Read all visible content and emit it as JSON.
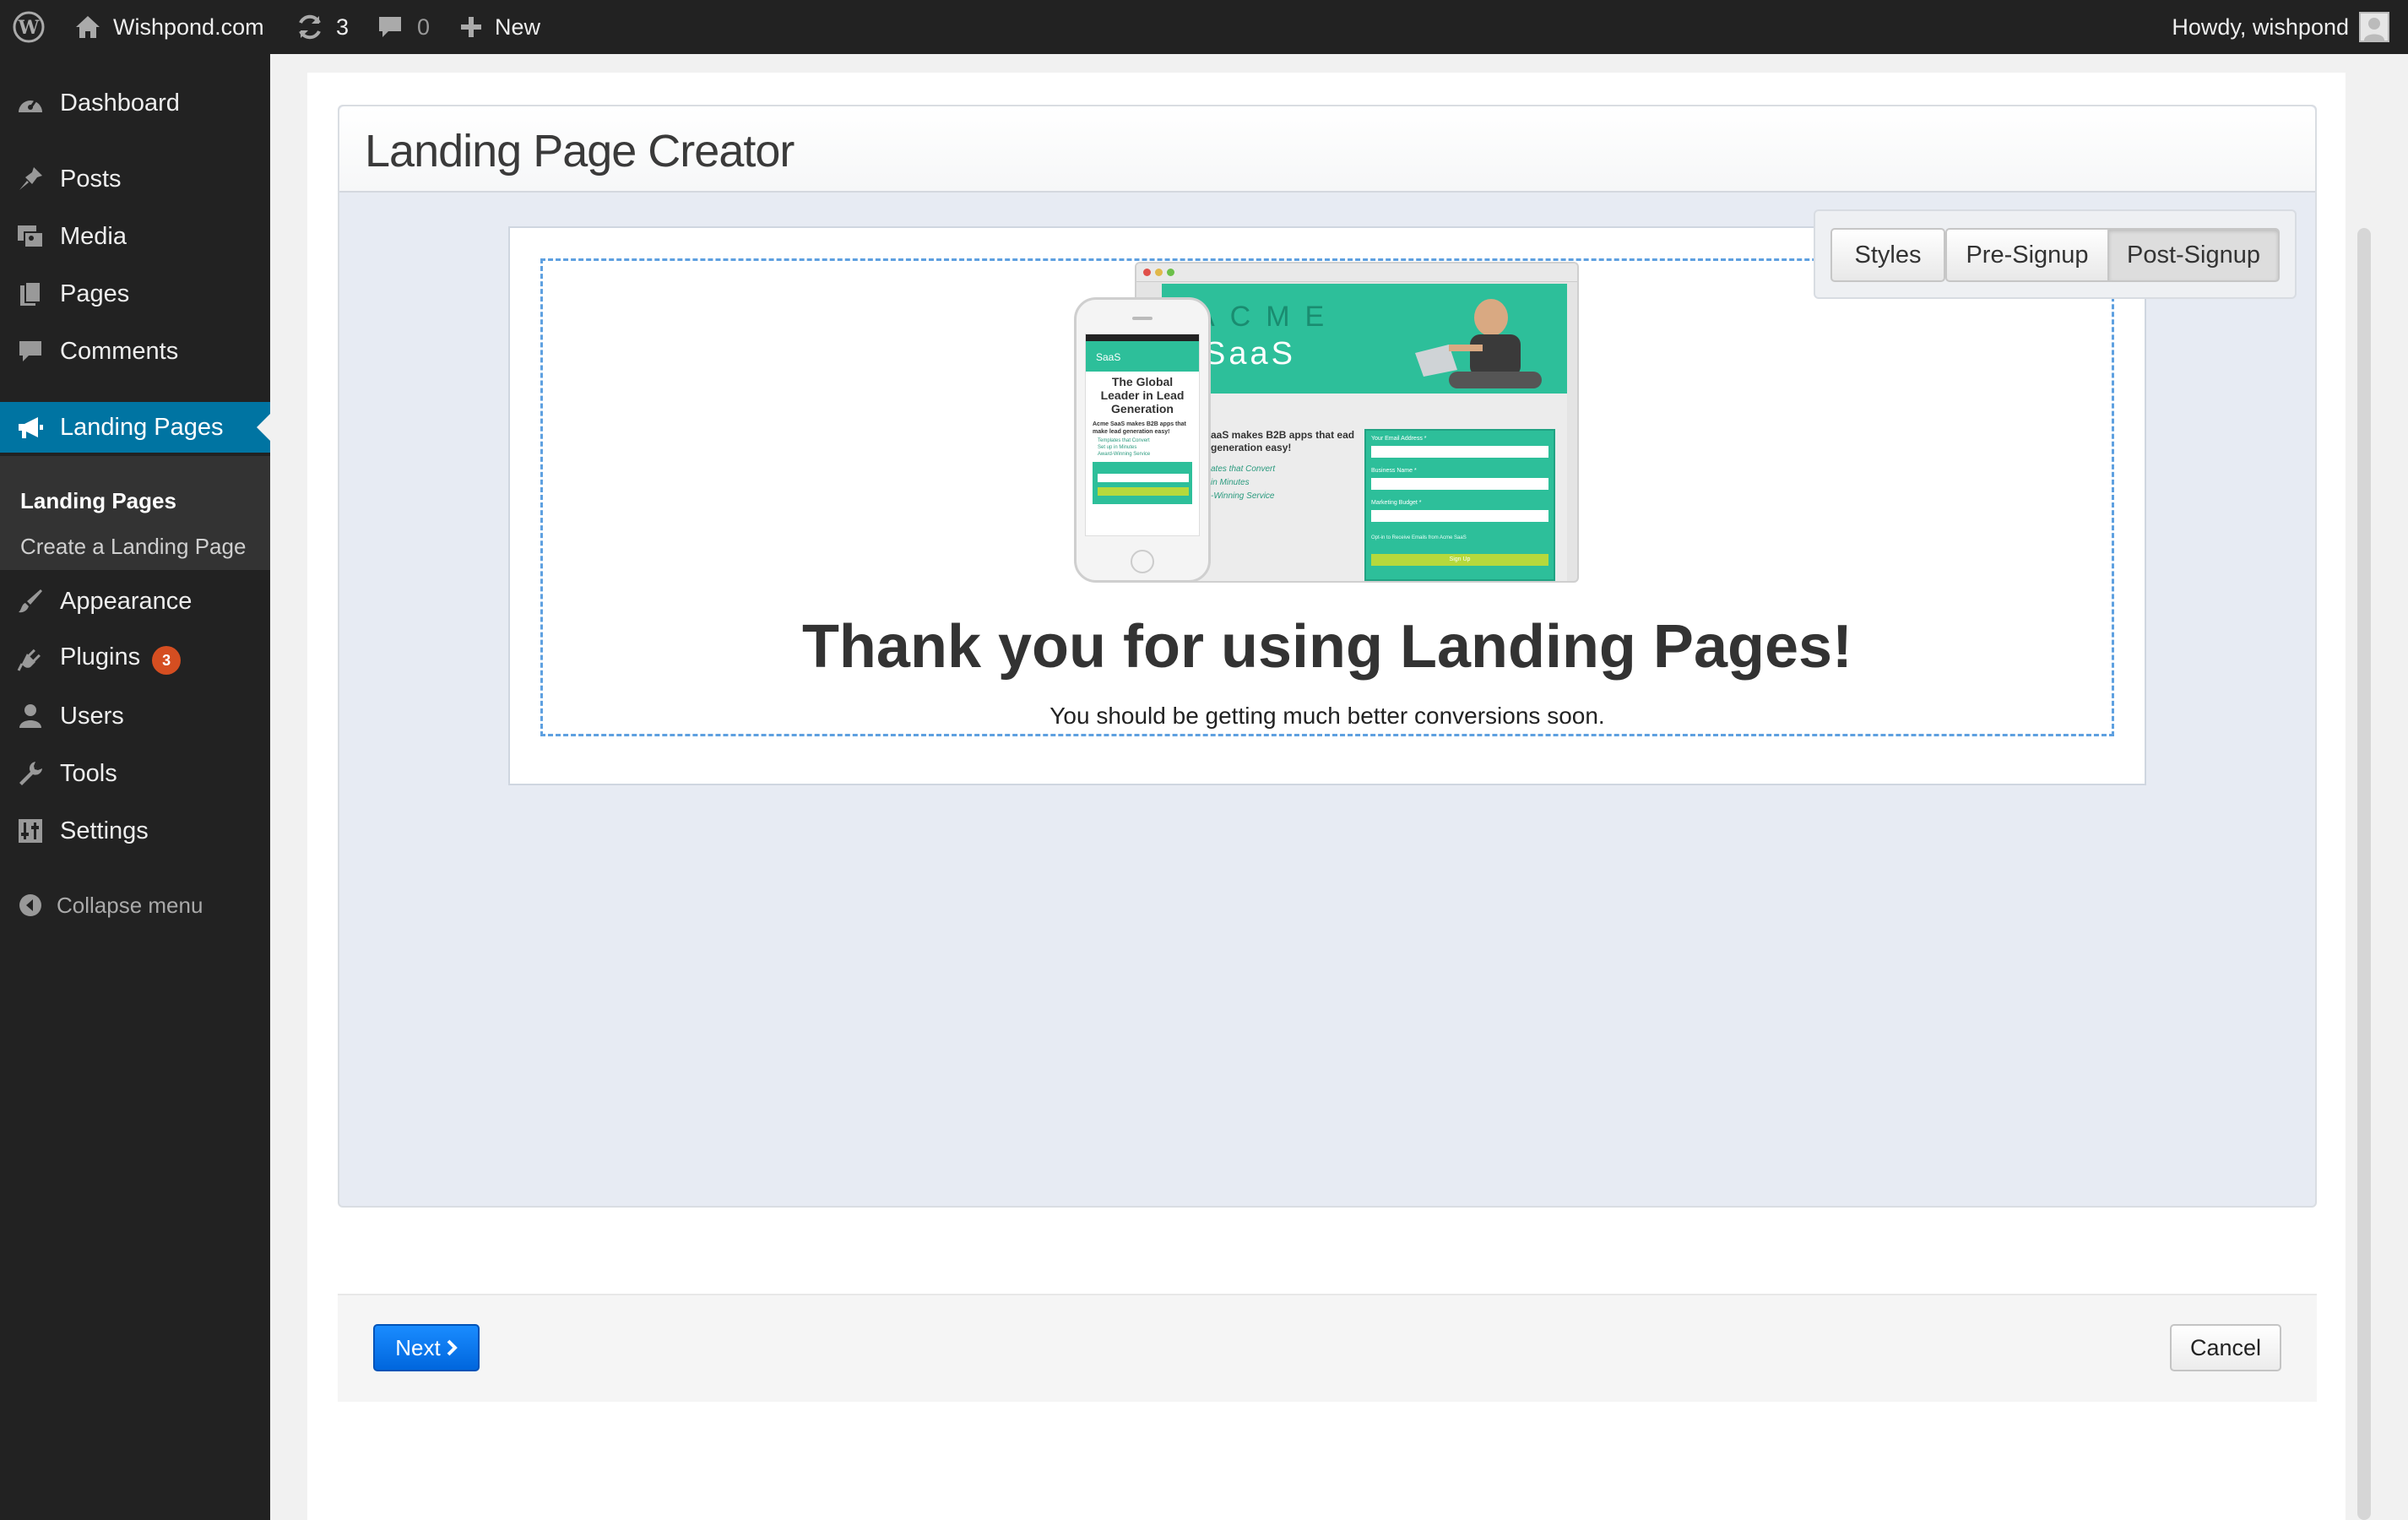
{
  "adminbar": {
    "site_name": "Wishpond.com",
    "updates_count": "3",
    "comments_count": "0",
    "new_label": "New",
    "howdy": "Howdy, wishpond"
  },
  "menu": {
    "dashboard": "Dashboard",
    "posts": "Posts",
    "media": "Media",
    "pages": "Pages",
    "comments": "Comments",
    "landing_pages": "Landing Pages",
    "sub_landing_pages": "Landing Pages",
    "sub_create": "Create a Landing Page",
    "appearance": "Appearance",
    "plugins": "Plugins",
    "plugins_badge": "3",
    "users": "Users",
    "tools": "Tools",
    "settings": "Settings",
    "collapse": "Collapse menu"
  },
  "main": {
    "title": "Landing Page Creator",
    "tabs": [
      "Styles",
      "Pre-Signup",
      "Post-Signup"
    ],
    "active_tab": "Post-Signup",
    "preview": {
      "heading": "Thank you for using Landing Pages!",
      "subheading": "You should be getting much better conversions soon.",
      "mock": {
        "brand_top": "ACME",
        "brand_bottom": "SaaS",
        "tagline": "aaS makes B2B apps that ead generation easy!",
        "bullets": [
          "ates that Convert",
          "in Minutes",
          "-Winning Service"
        ],
        "field_email": "Your Email Address *",
        "field_business": "Business Name *",
        "field_budget": "Marketing Budget *",
        "optin": "Opt-in to Receive Emails from Acme SaaS",
        "signup": "Sign Up",
        "phone_title": "The Global Leader in Lead Generation",
        "phone_body": "Acme SaaS makes B2B apps that make lead generation easy!",
        "phone_bullets": [
          "Templates that Convert",
          "Set up in Minutes",
          "Award-Winning Service"
        ]
      }
    }
  },
  "footer": {
    "next": "Next",
    "cancel": "Cancel"
  },
  "colors": {
    "adminbar_bg": "#222222",
    "menu_current": "#0074a2",
    "badge": "#d54e21",
    "panel_bg": "#e7ebf3",
    "next_button": "#0a7cf0",
    "preview_dashed": "#5ea0e0"
  }
}
